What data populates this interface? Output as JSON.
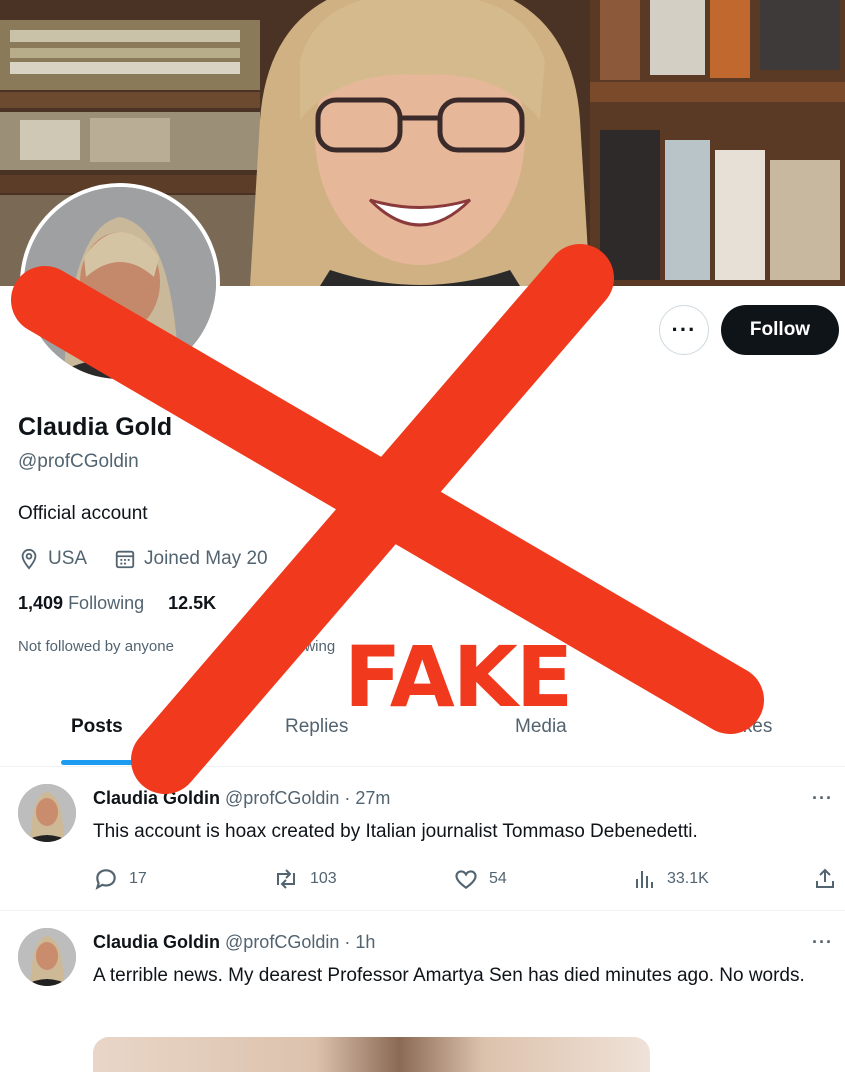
{
  "profile": {
    "display_name": "Claudia Gold",
    "handle": "@profCGoldin",
    "bio": "Official account",
    "location": "USA",
    "joined": "Joined May 20",
    "following_count": "1,409",
    "following_label": "Following",
    "followers_count": "12.5K",
    "not_followed_text": "Not followed by anyone",
    "not_followed_tail": "owing"
  },
  "buttons": {
    "more_label": "···",
    "follow_label": "Follow"
  },
  "tabs": [
    {
      "label": "Posts",
      "active": true
    },
    {
      "label": "Replies",
      "active": false
    },
    {
      "label": "Media",
      "active": false
    },
    {
      "label": "Likes",
      "active": false
    }
  ],
  "tweets": [
    {
      "name": "Claudia Goldin",
      "handle": "@profCGoldin",
      "time": "· 27m",
      "text": "This account is hoax created by Italian journalist Tommaso Debenedetti.",
      "replies": "17",
      "reposts": "103",
      "likes": "54",
      "views": "33.1K"
    },
    {
      "name": "Claudia Goldin",
      "handle": "@profCGoldin",
      "time": "· 1h",
      "text": "A terrible news. My dearest Professor Amartya Sen has died minutes ago. No words."
    }
  ],
  "overlay": {
    "stamp": "FAKE",
    "color": "#f0391d"
  },
  "colors": {
    "text_primary": "#0f1419",
    "text_secondary": "#536471",
    "accent": "#1d9bf0"
  }
}
